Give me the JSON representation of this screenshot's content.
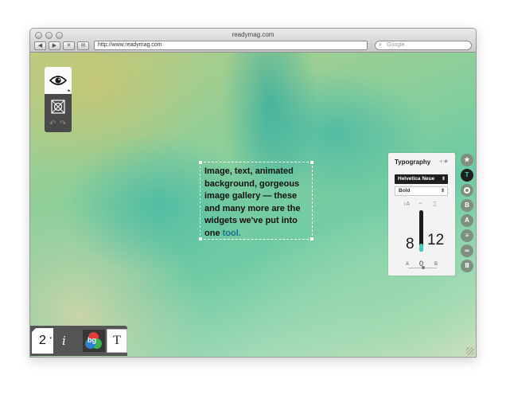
{
  "window": {
    "title": "readymag.com",
    "url": "http://www.readymag.com",
    "search_placeholder": "Google",
    "nav_buttons": [
      "◀",
      "▶",
      "✕",
      "✉"
    ]
  },
  "tools": {
    "undo_icon": "↶",
    "redo_icon": "↷"
  },
  "textbox": {
    "text_main": "Image, text, animated background, gorgeous image gallery — these and many more are the widgets we've put into one",
    "text_highlight": "tool."
  },
  "typography": {
    "title": "Typography",
    "star_icon": "+★",
    "font": "Helvetica Neue",
    "font_arrow": "⇕",
    "weight": "Bold",
    "weight_arrow": "⇕",
    "size_icon": "↕A",
    "kerning_icon": "⇔",
    "leading_icon": "⌶",
    "size": "8",
    "leading": "12",
    "size_level": 0.2,
    "tracking": "0",
    "tracking_left": "A",
    "tracking_right": "B"
  },
  "side_icons": [
    {
      "name": "star-icon",
      "glyph": "★"
    },
    {
      "name": "text-icon",
      "glyph": "T",
      "active": true
    },
    {
      "name": "circle-icon",
      "glyph": ""
    },
    {
      "name": "bold-icon",
      "glyph": "B"
    },
    {
      "name": "font-case-icon",
      "glyph": "A"
    },
    {
      "name": "align-icon",
      "glyph": "≡"
    },
    {
      "name": "link-icon",
      "glyph": "∞"
    },
    {
      "name": "columns-icon",
      "glyph": "Ⅲ"
    }
  ],
  "bottom_bar": {
    "page_number": "2",
    "info_label": "i",
    "bg_label": "bg",
    "text_tool_label": "T"
  }
}
